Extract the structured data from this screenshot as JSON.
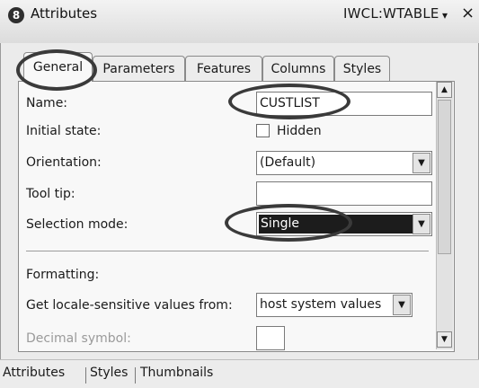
{
  "window": {
    "title": "Attributes",
    "title_icon": "8",
    "context": "IWCL:WTABLE",
    "menu_glyph": "▾",
    "close_glyph": "×"
  },
  "tabs": [
    {
      "label": "General",
      "active": true
    },
    {
      "label": "Parameters",
      "active": false
    },
    {
      "label": "Features",
      "active": false
    },
    {
      "label": "Columns",
      "active": false
    },
    {
      "label": "Styles",
      "active": false
    }
  ],
  "form": {
    "name_label": "Name:",
    "name_value": "CUSTLIST",
    "initial_state_label": "Initial state:",
    "hidden_label": "Hidden",
    "hidden_checked": false,
    "orientation_label": "Orientation:",
    "orientation_value": "(Default)",
    "tooltip_label": "Tool tip:",
    "tooltip_value": "",
    "selection_mode_label": "Selection mode:",
    "selection_mode_value": "Single",
    "formatting_label": "Formatting:",
    "locale_label": "Get locale-sensitive values from:",
    "locale_value": "host system values",
    "decimal_label": "Decimal symbol:"
  },
  "bottom_tabs": [
    {
      "label": "Attributes"
    },
    {
      "label": "Styles"
    },
    {
      "label": "Thumbnails"
    }
  ],
  "glyphs": {
    "arrow_down": "▼",
    "arrow_up": "▲"
  },
  "colors": {
    "selection_bg": "#1c1c1c",
    "selection_fg": "#ffffff",
    "annotation": "#3a3a3a"
  }
}
